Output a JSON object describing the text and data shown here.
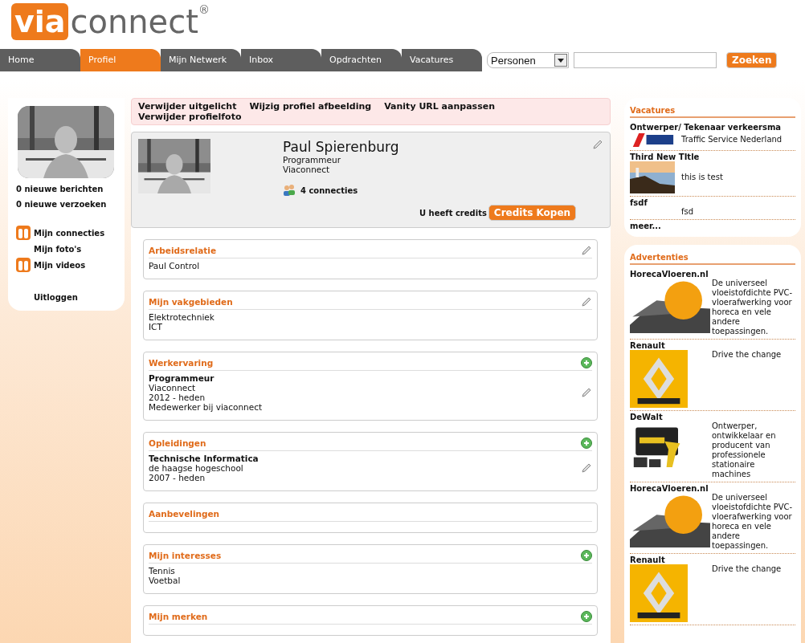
{
  "logo": {
    "mark": "via",
    "word": "connect",
    "symbol": "®"
  },
  "nav": {
    "tabs": [
      {
        "label": "Home",
        "selected": false
      },
      {
        "label": "Profiel",
        "selected": true
      },
      {
        "label": "Mijn Netwerk",
        "selected": false
      },
      {
        "label": "Inbox",
        "selected": false
      },
      {
        "label": "Opdrachten",
        "selected": false
      },
      {
        "label": "Vacatures",
        "selected": false
      }
    ],
    "search": {
      "scope": "Personen",
      "button": "Zoeken"
    }
  },
  "sidebar": {
    "stats": [
      "0 nieuwe berichten",
      "0 nieuwe verzoeken"
    ],
    "links": [
      {
        "label": "Mijn connecties",
        "icon": true
      },
      {
        "label": "Mijn foto's",
        "icon": false
      },
      {
        "label": "Mijn videos",
        "icon": true
      }
    ],
    "logout": "Uitloggen"
  },
  "actions": [
    "Verwijder uitgelicht",
    "Wijzig profiel afbeelding",
    "Vanity URL aanpassen",
    "Verwijder profielfoto"
  ],
  "profile": {
    "name": "Paul Spierenburg",
    "role": "Programmeur",
    "company": "Viaconnect",
    "connections": "4 connecties",
    "credits": "U heeft credits",
    "buy": "Credits Kopen"
  },
  "sections": [
    {
      "title": "Arbeidsrelatie",
      "edit": true,
      "add": false,
      "items": [
        {
          "lines": [
            "Paul Control"
          ],
          "editable": false
        }
      ]
    },
    {
      "title": "Mijn vakgebieden",
      "edit": true,
      "add": false,
      "items": [
        {
          "lines": [
            "Elektrotechniek",
            "ICT"
          ],
          "editable": false
        }
      ]
    },
    {
      "title": "Werkervaring",
      "edit": false,
      "add": true,
      "items": [
        {
          "heading": "Programmeur",
          "lines": [
            "Viaconnect",
            "2012 - heden",
            "Medewerker bij viaconnect"
          ],
          "editable": true
        }
      ]
    },
    {
      "title": "Opleidingen",
      "edit": false,
      "add": true,
      "items": [
        {
          "heading": "Technische Informatica",
          "lines": [
            "de haagse hogeschool",
            "2007 - heden"
          ],
          "editable": true
        }
      ]
    },
    {
      "title": "Aanbevelingen",
      "edit": false,
      "add": false
    },
    {
      "title": "Mijn interesses",
      "edit": false,
      "add": true,
      "items": [
        {
          "lines": [
            "Tennis",
            "Voetbal"
          ],
          "editable": false
        }
      ]
    },
    {
      "title": "Mijn merken",
      "edit": false,
      "add": true
    }
  ],
  "vacancies": {
    "title": "Vacatures",
    "items": [
      {
        "title": "Ontwerper/ Tekenaar verkeersma",
        "text": "Traffic Service Nederland",
        "kind": "logo"
      },
      {
        "title": "Third New TItle",
        "text": "this is test"
      },
      {
        "title": "fsdf",
        "text": "fsd",
        "kind": "blank"
      }
    ],
    "more": "meer..."
  },
  "ads": {
    "title": "Advertenties",
    "items": [
      {
        "title": "HorecaVloeren.nl",
        "text": "De universeel vloeistofdichte PVC-vloerafwerking voor horeca en vele andere toepassingen.",
        "kind": "floor"
      },
      {
        "title": "Renault",
        "text": "Drive the change",
        "kind": "emblem"
      },
      {
        "title": "DeWalt",
        "text": "Ontwerper, ontwikkelaar en producent van professionele stationaire machines",
        "kind": "tool"
      },
      {
        "title": "HorecaVloeren.nl",
        "text": "De universeel vloeistofdichte PVC-vloerafwerking voor horeca en vele andere toepassingen.",
        "kind": "floor"
      },
      {
        "title": "Renault",
        "text": "Drive the change",
        "kind": "emblem"
      }
    ]
  }
}
